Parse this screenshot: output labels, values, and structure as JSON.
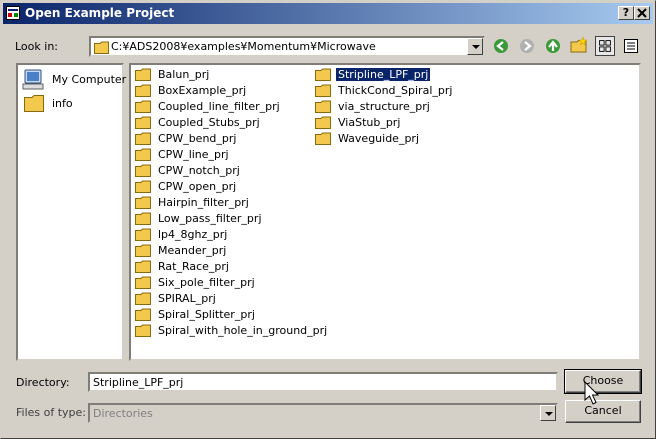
{
  "window": {
    "title": "Open Example Project",
    "help_button": "?",
    "close_button": "X"
  },
  "lookin": {
    "label": "Look in:",
    "path": "C:¥ADS2008¥examples¥Momentum¥Microwave"
  },
  "places": [
    {
      "label": "My Computer",
      "icon": "computer-icon"
    },
    {
      "label": "info",
      "icon": "folder-icon"
    }
  ],
  "files": {
    "column1": [
      "Balun_prj",
      "BoxExample_prj",
      "Coupled_line_filter_prj",
      "Coupled_Stubs_prj",
      "CPW_bend_prj",
      "CPW_line_prj",
      "CPW_notch_prj",
      "CPW_open_prj",
      "Hairpin_filter_prj",
      "Low_pass_filter_prj",
      "lp4_8ghz_prj",
      "Meander_prj",
      "Rat_Race_prj",
      "Six_pole_filter_prj",
      "SPIRAL_prj",
      "Spiral_Splitter_prj",
      "Spiral_with_hole_in_ground_prj"
    ],
    "column2": [
      "Stripline_LPF_prj",
      "ThickCond_Spiral_prj",
      "via_structure_prj",
      "ViaStub_prj",
      "Waveguide_prj"
    ],
    "selected": "Stripline_LPF_prj"
  },
  "directory": {
    "label": "Directory:",
    "value": "Stripline_LPF_prj"
  },
  "filetype": {
    "label": "Files of type:",
    "value": "Directories"
  },
  "buttons": {
    "choose": "Choose",
    "cancel": "Cancel"
  },
  "colors": {
    "titlebar_start": "#0a246a",
    "titlebar_end": "#a6caf0",
    "dialog_bg": "#d4d0c8",
    "selection": "#0a246a",
    "folder": "#f2c94c"
  }
}
